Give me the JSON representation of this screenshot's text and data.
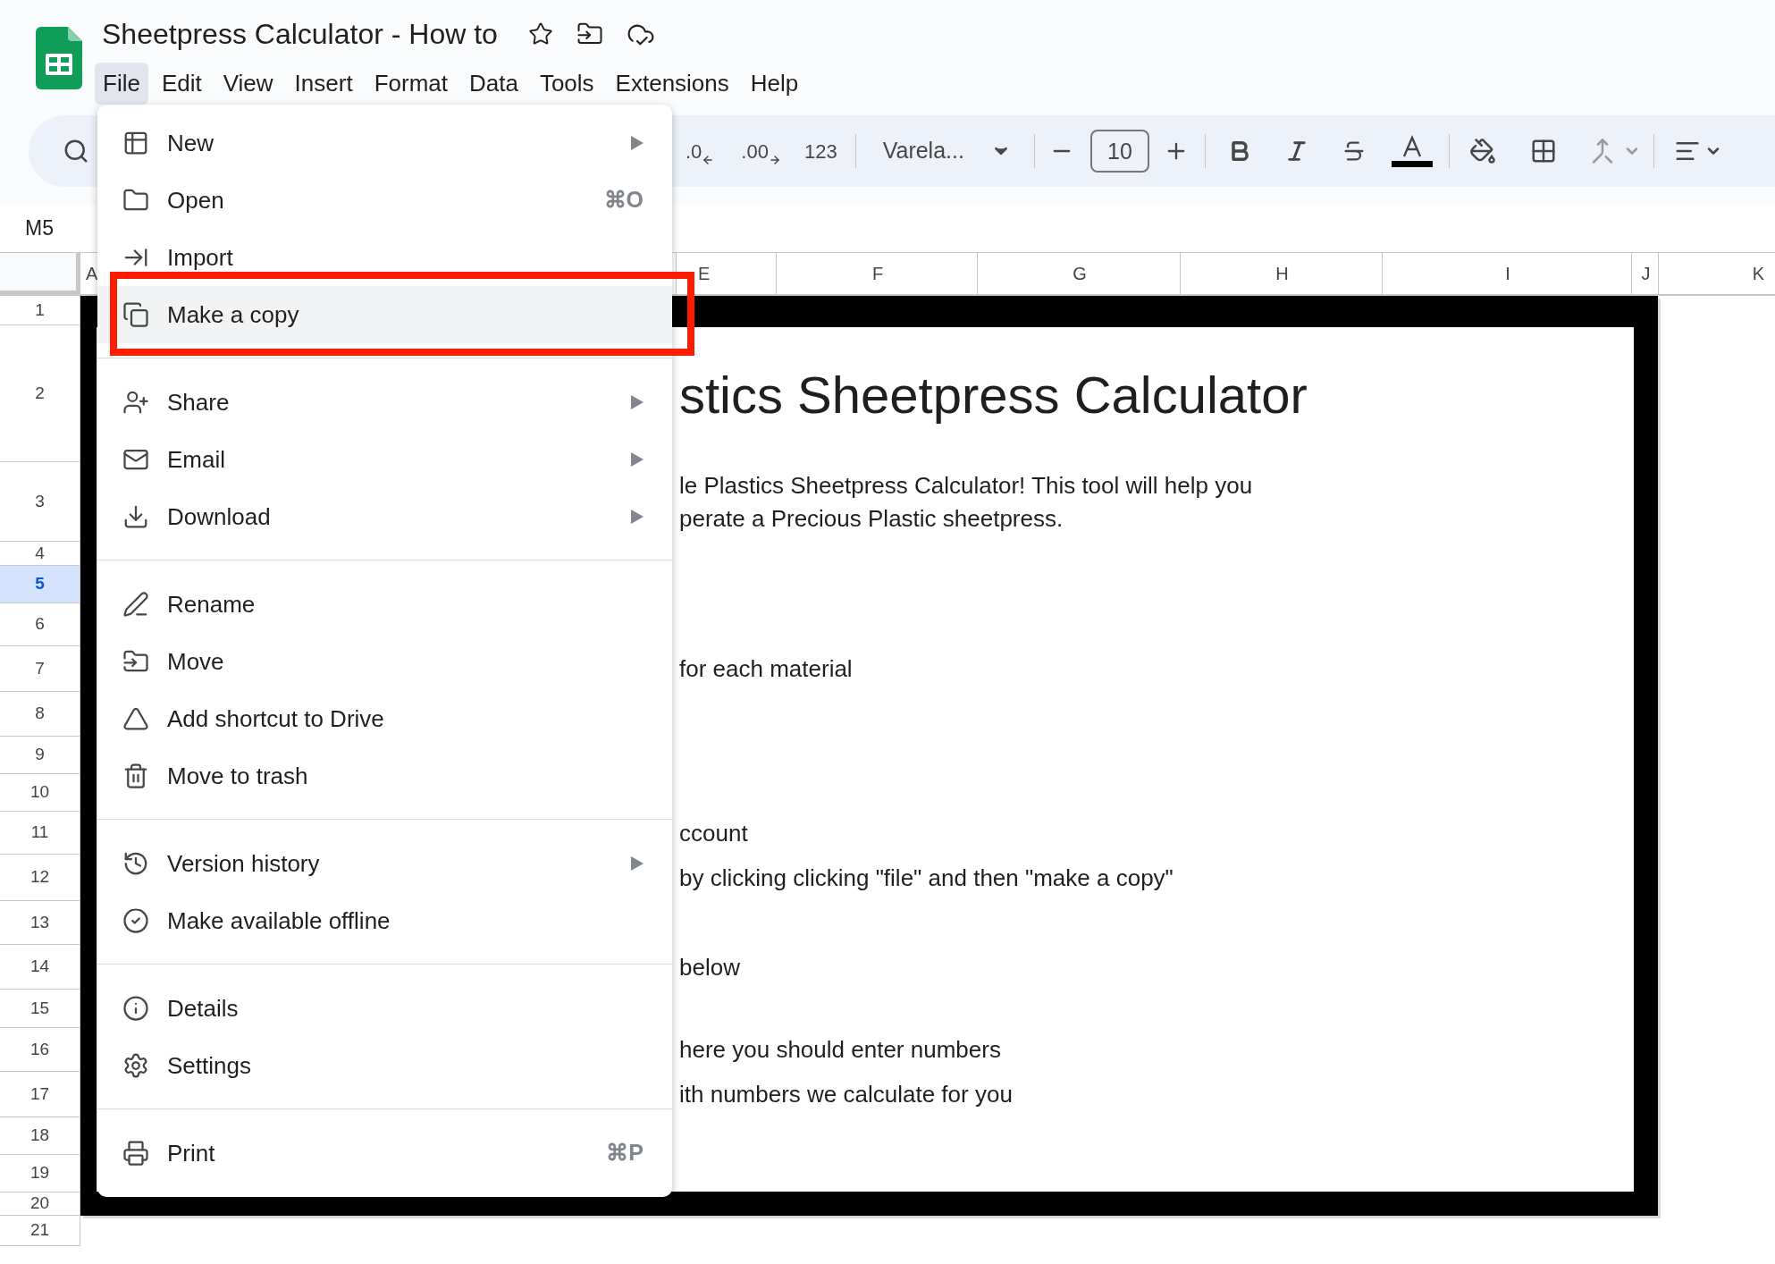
{
  "document": {
    "title": "Sheetpress Calculator - How to"
  },
  "menubar": [
    {
      "label": "File",
      "selected": true
    },
    {
      "label": "Edit",
      "selected": false
    },
    {
      "label": "View",
      "selected": false
    },
    {
      "label": "Insert",
      "selected": false
    },
    {
      "label": "Format",
      "selected": false
    },
    {
      "label": "Data",
      "selected": false
    },
    {
      "label": "Tools",
      "selected": false
    },
    {
      "label": "Extensions",
      "selected": false
    },
    {
      "label": "Help",
      "selected": false
    }
  ],
  "toolbar": {
    "decrease_decimal": ".0",
    "increase_decimal": ".00",
    "number_format": "123",
    "font": "Varela...",
    "font_size": "10"
  },
  "name_box": "M5",
  "columns": [
    {
      "label": "A"
    },
    {
      "label": "E"
    },
    {
      "label": "F"
    },
    {
      "label": "G"
    },
    {
      "label": "H"
    },
    {
      "label": "I"
    },
    {
      "label": "J"
    },
    {
      "label": "K"
    }
  ],
  "rows": [
    {
      "label": "1",
      "selected": false
    },
    {
      "label": "2",
      "selected": false,
      "cell": {
        "kind": "title",
        "lines": [
          "stics Sheetpress Calculator"
        ]
      }
    },
    {
      "label": "3",
      "selected": false,
      "cell": {
        "kind": "body",
        "lines": [
          "le Plastics Sheetpress Calculator! This tool will help you",
          "perate a Precious Plastic sheetpress."
        ]
      }
    },
    {
      "label": "4",
      "selected": false
    },
    {
      "label": "5",
      "selected": true
    },
    {
      "label": "6",
      "selected": false
    },
    {
      "label": "7",
      "selected": false,
      "cell": {
        "kind": "body",
        "lines": [
          "for each material"
        ]
      }
    },
    {
      "label": "8",
      "selected": false
    },
    {
      "label": "9",
      "selected": false
    },
    {
      "label": "10",
      "selected": false
    },
    {
      "label": "11",
      "selected": false,
      "cell": {
        "kind": "body",
        "lines": [
          "ccount"
        ]
      }
    },
    {
      "label": "12",
      "selected": false,
      "cell": {
        "kind": "body",
        "lines": [
          "by clicking clicking \"file\" and then \"make a copy\""
        ]
      }
    },
    {
      "label": "13",
      "selected": false
    },
    {
      "label": "14",
      "selected": false,
      "cell": {
        "kind": "body",
        "lines": [
          "below"
        ]
      }
    },
    {
      "label": "15",
      "selected": false
    },
    {
      "label": "16",
      "selected": false,
      "cell": {
        "kind": "body",
        "lines": [
          "here you should enter numbers"
        ]
      }
    },
    {
      "label": "17",
      "selected": false,
      "cell": {
        "kind": "body",
        "lines": [
          "ith numbers we calculate for you"
        ]
      }
    },
    {
      "label": "18",
      "selected": false
    },
    {
      "label": "19",
      "selected": false
    },
    {
      "label": "20",
      "selected": false
    },
    {
      "label": "21",
      "selected": false
    }
  ],
  "file_menu": {
    "sections": [
      [
        {
          "label": "New",
          "submenu": true,
          "selected": false
        },
        {
          "label": "Open",
          "submenu": false,
          "shortcut": "⌘O",
          "selected": false
        },
        {
          "label": "Import",
          "submenu": false,
          "selected": false
        },
        {
          "label": "Make a copy",
          "submenu": false,
          "selected": true
        }
      ],
      [
        {
          "label": "Share",
          "submenu": true,
          "selected": false
        },
        {
          "label": "Email",
          "submenu": true,
          "selected": false
        },
        {
          "label": "Download",
          "submenu": true,
          "selected": false
        }
      ],
      [
        {
          "label": "Rename",
          "submenu": false,
          "selected": false
        },
        {
          "label": "Move",
          "submenu": false,
          "selected": false
        },
        {
          "label": "Add shortcut to Drive",
          "submenu": false,
          "selected": false
        },
        {
          "label": "Move to trash",
          "submenu": false,
          "selected": false
        }
      ],
      [
        {
          "label": "Version history",
          "submenu": true,
          "selected": false
        },
        {
          "label": "Make available offline",
          "submenu": false,
          "selected": false
        }
      ],
      [
        {
          "label": "Details",
          "submenu": false,
          "selected": false
        },
        {
          "label": "Settings",
          "submenu": false,
          "selected": false
        }
      ],
      [
        {
          "label": "Print",
          "submenu": false,
          "shortcut": "⌘P",
          "selected": false
        }
      ]
    ]
  }
}
